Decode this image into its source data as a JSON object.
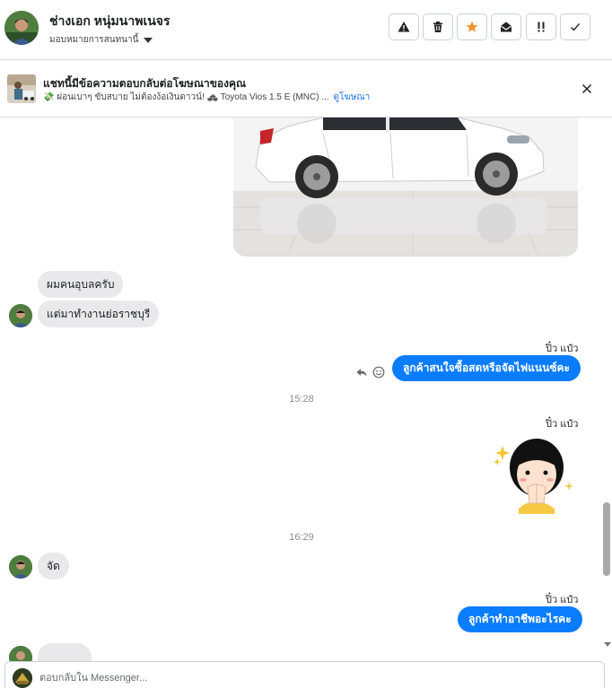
{
  "header": {
    "contact_name": "ช่างเอก หนุ่มนาพเนจร",
    "assign_label": "มอบหมายการสนทนานี้",
    "actions": [
      {
        "icon": "warning-icon",
        "label": "Report"
      },
      {
        "icon": "trash-icon",
        "label": "Delete"
      },
      {
        "icon": "star-icon",
        "label": "Star"
      },
      {
        "icon": "mail-open-icon",
        "label": "Mark unread"
      },
      {
        "icon": "priority-icon",
        "label": "Priority"
      },
      {
        "icon": "checkmark-icon",
        "label": "Done"
      }
    ],
    "colors": {
      "star": "#f0932b"
    }
  },
  "ad_banner": {
    "title": "แชทนี้มีข้อความตอบกลับต่อโฆษณาของคุณ",
    "subtitle": "💸 ผ่อนเบาๆ ขับสบาย ไม่ต้องง้อเงินดาวน์! 🚓 Toyota Vios 1.5 E (MNC) ...",
    "link_text": "ดูโฆษณา"
  },
  "messages": {
    "in_1": "ผมคนอุบลครับ",
    "in_2": "แต่มาทำงานย่อราชบุรี",
    "sender_out": "ปิ๋ว แป๋ว",
    "out_1": "ลูกค้าสนใจซื้อสดหรือจัดไฟแนนซ์คะ",
    "time_1": "15:28",
    "time_2": "16:29",
    "in_3": "จัด",
    "out_2": "ลูกค้าทำอาชีพอะไรคะ"
  },
  "composer": {
    "placeholder": "ตอบกลับใน Messenger..."
  },
  "colors": {
    "outgoing_bubble": "#0a7cff",
    "incoming_bubble": "#e9e9eb",
    "link": "#1a73e8"
  }
}
